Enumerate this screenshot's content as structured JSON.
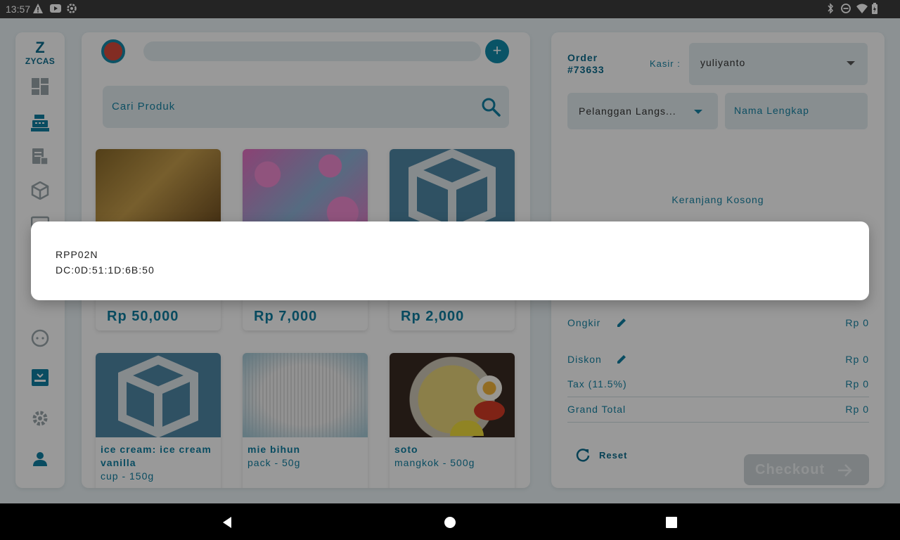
{
  "status_bar": {
    "time": "13:57"
  },
  "rail": {
    "logo_mark": "Z",
    "logo_name": "ZYCAS",
    "items": [
      "dashboard-icon",
      "cashier-icon",
      "report-icon",
      "product-box-icon",
      "customer-icon",
      "inbox-icon",
      "settings-icon",
      "user-icon"
    ]
  },
  "products": {
    "add_label": "+",
    "search_placeholder": "Cari Produk",
    "cards": [
      {
        "price": "Rp 50,000"
      },
      {
        "price": "Rp 7,000"
      },
      {
        "price": "Rp 2,000"
      },
      {
        "name": "ice cream: ice cream vanilla",
        "unit": "cup -  150g"
      },
      {
        "name": "mie bihun",
        "unit": "pack -  50g"
      },
      {
        "name": "soto",
        "unit": "mangkok -  500g"
      }
    ]
  },
  "order": {
    "title": "Order #73633",
    "kasir_label": "Kasir :",
    "kasir_value": "yuliyanto",
    "customer_value": "Pelanggan Langs...",
    "name_placeholder": "Nama Lengkap",
    "empty_text": "Keranjang Kosong",
    "rows": [
      {
        "label": "Ongkir",
        "value": "Rp 0"
      },
      {
        "label": "Diskon",
        "value": "Rp 0"
      },
      {
        "label": "Tax (11.5%)",
        "value": "Rp 0"
      },
      {
        "label": "Grand Total",
        "value": "Rp 0"
      }
    ],
    "reset_label": "Reset",
    "checkout_label": "Checkout"
  },
  "dialog": {
    "line1": "RPP02N",
    "line2": "DC:0D:51:1D:6B:50"
  },
  "colors": {
    "accent": "#0f8bab",
    "text_accent": "#1684a5"
  }
}
